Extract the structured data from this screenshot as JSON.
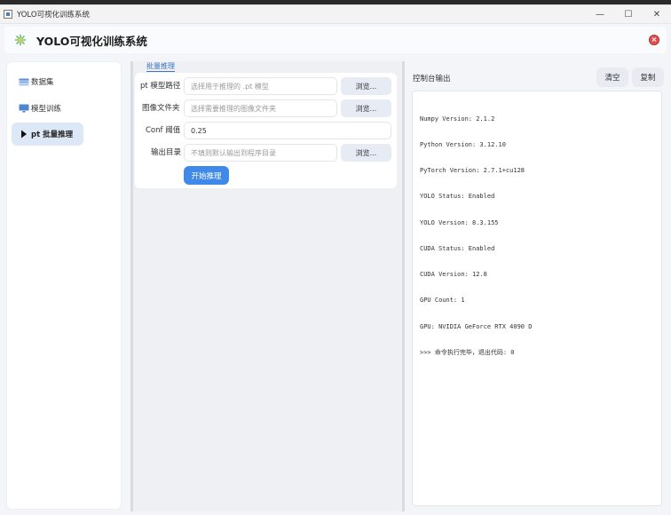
{
  "window": {
    "title": "YOLO可视化训练系统",
    "controls": {
      "minimize": "—",
      "maximize": "☐",
      "close": "✕"
    }
  },
  "header": {
    "title": "YOLO可视化训练系统",
    "logo_icon": "sparkle-icon",
    "close_icon": "close-circle-icon"
  },
  "sidebar": {
    "items": [
      {
        "label": "数据集",
        "icon": "database-icon",
        "active": false
      },
      {
        "label": "模型训练",
        "icon": "monitor-icon",
        "active": false
      },
      {
        "label": "pt 批量推理",
        "icon": "play-triangle-icon",
        "active": true
      }
    ]
  },
  "inference": {
    "section_label": "批量推理",
    "model_path": {
      "label": "pt 模型路径",
      "placeholder": "选择用于推理的 .pt 模型",
      "browse": "浏览..."
    },
    "image_dir": {
      "label": "图像文件夹",
      "placeholder": "选择需要推理的图像文件夹",
      "browse": "浏览..."
    },
    "conf": {
      "label": "Conf 阈值",
      "value": "0.25"
    },
    "output_dir": {
      "label": "输出目录",
      "placeholder": "不填则默认输出到程序目录",
      "browse": "浏览..."
    },
    "start_button": "开始推理"
  },
  "console": {
    "title": "控制台输出",
    "clear_button": "清空",
    "copy_button": "复制",
    "lines": [
      "Numpy Version: 2.1.2",
      "Python Version: 3.12.10",
      "PyTorch Version: 2.7.1+cu128",
      "YOLO Status: Enabled",
      "YOLO Version: 8.3.155",
      "CUDA Status: Enabled",
      "CUDA Version: 12.8",
      "GPU Count: 1",
      "GPU: NVIDIA GeForce RTX 4090 D",
      ">>> 命令执行完毕，退出代码: 0"
    ]
  },
  "colors": {
    "accent": "#3f8ae8",
    "active_nav_bg": "#dde8f7",
    "close_red": "#e05050",
    "link_blue": "#3a73c8"
  }
}
